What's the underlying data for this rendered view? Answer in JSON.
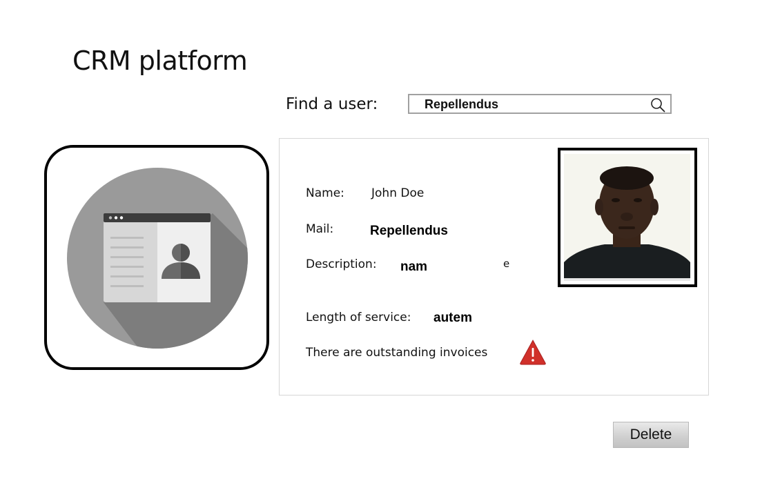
{
  "app": {
    "title": "CRM platform"
  },
  "search": {
    "label": "Find a user:",
    "value": "Repellendus"
  },
  "profile": {
    "name_label": "Name:",
    "name_value": "John Doe",
    "mail_label": "Mail:",
    "mail_value": "Repellendus",
    "description_label": "Description:",
    "description_value": "nam",
    "description_trailing_fragment": "e",
    "service_label": "Length of service:",
    "service_value": "autem",
    "invoice_notice": "There are outstanding invoices"
  },
  "actions": {
    "delete_label": "Delete"
  },
  "icons": {
    "search": "search-icon",
    "app_logo": "contact-card-icon",
    "user_photo": "user-photo",
    "warning": "warning-triangle-icon"
  },
  "colors": {
    "warning": "#d0302a",
    "logo_circle": "#9a9a9a",
    "logo_shadow": "#7a7a7a"
  }
}
